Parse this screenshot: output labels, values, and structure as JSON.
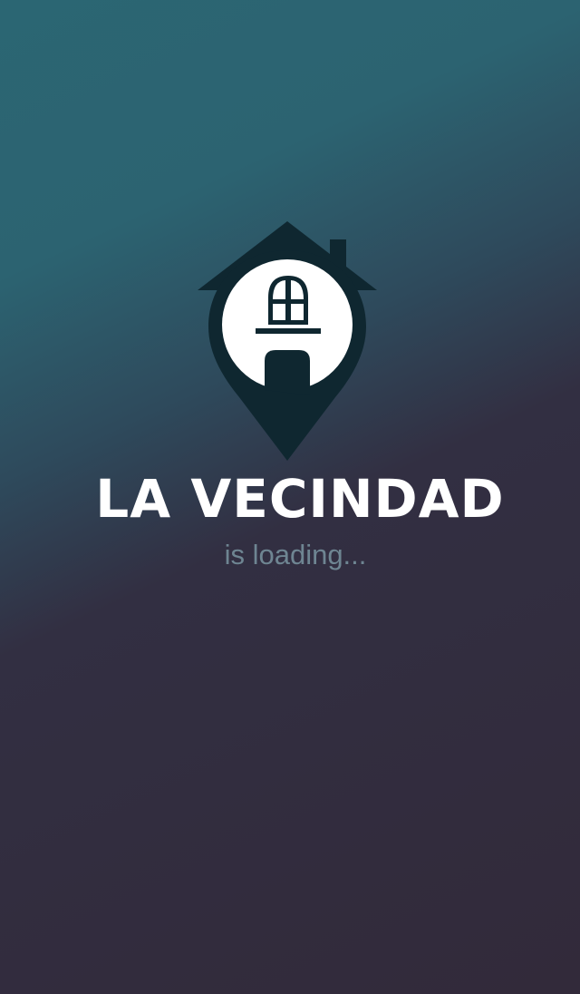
{
  "splash": {
    "app_name": "LA VECINDAD",
    "status_text": "is loading...",
    "logo_icon": "house-location-pin-icon"
  },
  "colors": {
    "background_top": "#2b6673",
    "background_bottom": "#322a3a",
    "logo_dark": "#0f2730",
    "title": "#ffffff",
    "status": "#6e8592"
  }
}
